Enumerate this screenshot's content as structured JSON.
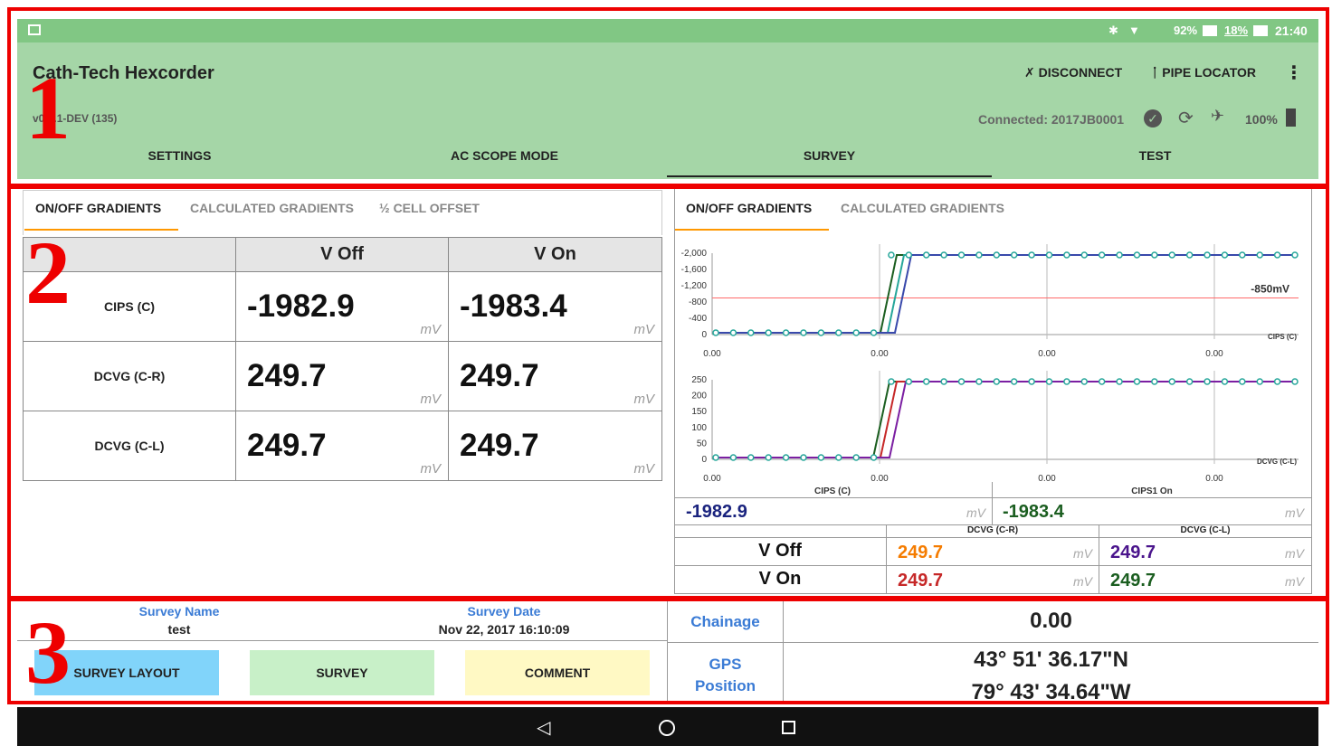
{
  "status_bar": {
    "battery_pct": "92%",
    "data_pct": "18%",
    "time": "21:40"
  },
  "app": {
    "title": "Cath-Tech Hexcorder",
    "version": "v0.1.1-DEV (135)",
    "disconnect_label": "DISCONNECT",
    "pipe_locator_label": "PIPE LOCATOR",
    "connected_text": "Connected: 2017JB0001",
    "device_battery": "100%"
  },
  "tabs": [
    "SETTINGS",
    "AC SCOPE MODE",
    "SURVEY",
    "TEST"
  ],
  "left_panel": {
    "subtabs": [
      "ON/OFF GRADIENTS",
      "CALCULATED GRADIENTS",
      "½ CELL OFFSET"
    ],
    "col_headers": [
      "V Off",
      "V On"
    ],
    "rows": [
      {
        "label": "CIPS (C)",
        "v_off": "-1982.9",
        "v_on": "-1983.4"
      },
      {
        "label": "DCVG (C-R)",
        "v_off": "249.7",
        "v_on": "249.7"
      },
      {
        "label": "DCVG (C-L)",
        "v_off": "249.7",
        "v_on": "249.7"
      }
    ],
    "unit": "mV"
  },
  "right_panel": {
    "subtabs": [
      "ON/OFF GRADIENTS",
      "CALCULATED GRADIENTS"
    ],
    "cips_off": "-1982.9",
    "cips_on": "-1983.4",
    "unit": "mV",
    "col_headers": [
      "DCVG (C-R)",
      "DCVG (C-L)"
    ],
    "row_labels": [
      "V Off",
      "V On"
    ],
    "voff_cr": "249.7",
    "voff_cl": "249.7",
    "von_cr": "249.7",
    "von_cl": "249.7",
    "colors": {
      "cips_off": "#1a237e",
      "cips_on": "#1b5e20",
      "voff_cr": "#f57c00",
      "voff_cl": "#4a148c",
      "von_cr": "#c62828",
      "von_cl": "#1b5e20"
    }
  },
  "chart_data": [
    {
      "type": "line",
      "yticks": [
        "-2,000",
        "-1,600",
        "-1,200",
        "-800",
        "-400",
        "0"
      ],
      "xticks": [
        "0.00",
        "0.00",
        "0.00",
        "0.00"
      ],
      "threshold_label": "-850mV",
      "corner_label": "CIPS (C)",
      "x_title": ""
    },
    {
      "type": "line",
      "yticks": [
        "250",
        "200",
        "150",
        "100",
        "50",
        "0"
      ],
      "xticks": [
        "0.00",
        "0.00",
        "0.00",
        "0.00"
      ],
      "corner_label": "DCVG (C-L)",
      "bottom_labels": [
        "CIPS (C)",
        "CIPS1 On"
      ]
    }
  ],
  "survey": {
    "name_label": "Survey Name",
    "name": "test",
    "date_label": "Survey Date",
    "date": "Nov 22, 2017 16:10:09",
    "buttons": [
      "SURVEY LAYOUT",
      "SURVEY",
      "COMMENT"
    ],
    "chainage_label": "Chainage",
    "chainage": "0.00",
    "gps_label_1": "GPS",
    "gps_label_2": "Position",
    "lat": "43° 51' 36.17\"N",
    "lon": "79° 43' 34.64\"W"
  },
  "annotations": [
    "1",
    "2",
    "3"
  ]
}
